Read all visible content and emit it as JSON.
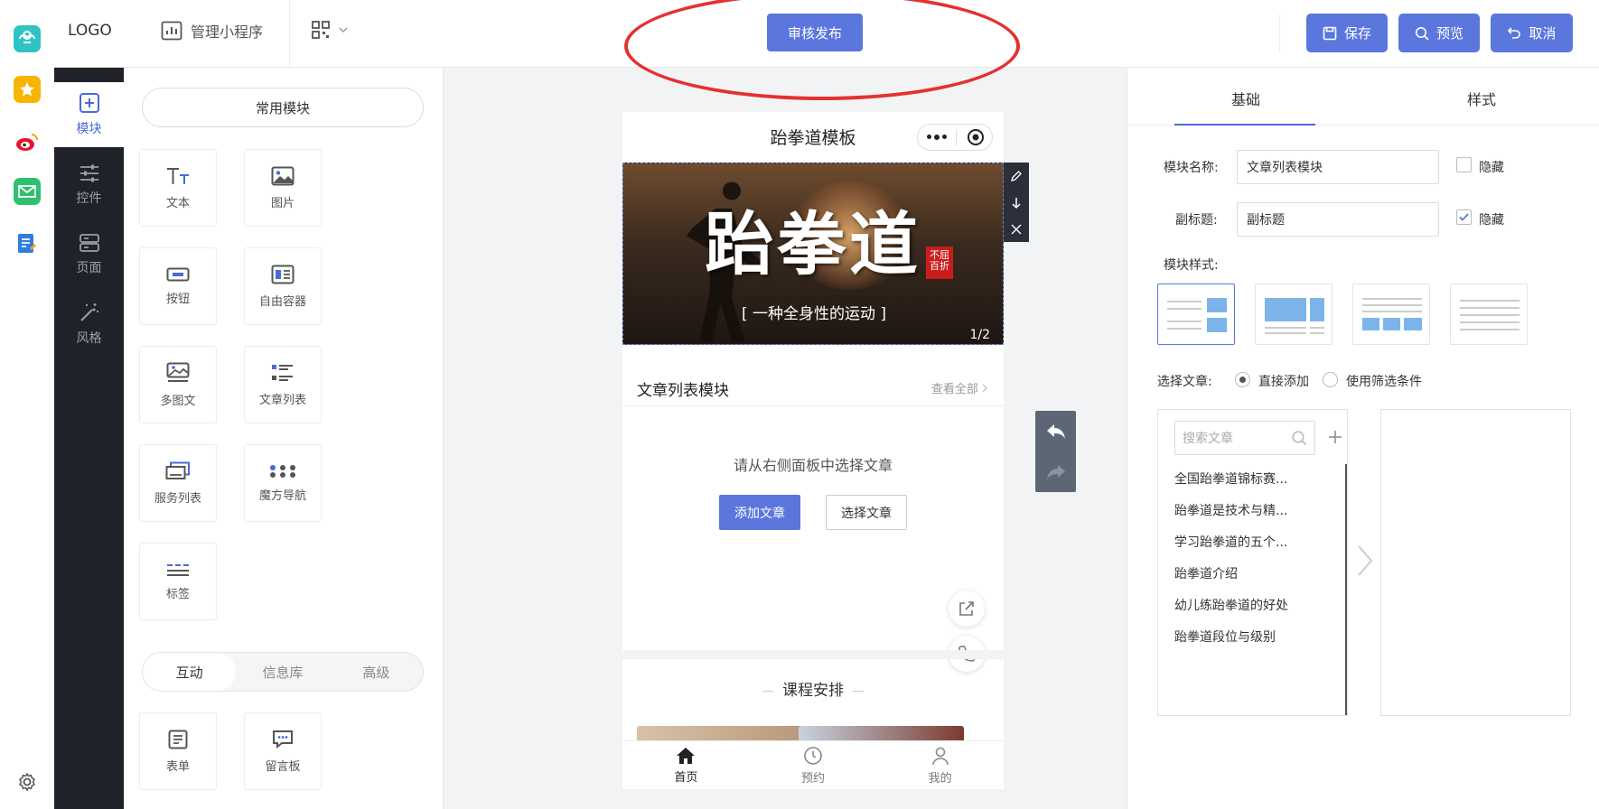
{
  "topbar": {
    "logo": "LOGO",
    "manage": "管理小程序",
    "publish": "审核发布",
    "save": "保存",
    "preview": "预览",
    "cancel": "取消"
  },
  "nav": {
    "modules": "模块",
    "controls": "控件",
    "pages": "页面",
    "style": "风格"
  },
  "widgets": {
    "common_tab": "常用模块",
    "text": "文本",
    "image": "图片",
    "button": "按钮",
    "free_container": "自由容器",
    "multi_image_text": "多图文",
    "article_list": "文章列表",
    "service_list": "服务列表",
    "magic_nav": "魔方导航",
    "tag": "标签",
    "lower_tabs": [
      "互动",
      "信息库",
      "高级"
    ],
    "form": "表单",
    "message_board": "留言板"
  },
  "phone": {
    "title": "跆拳道模板",
    "banner_title": "跆拳道",
    "banner_seal": "不屈百折",
    "banner_subtitle": "[ 一种全身性的运动 ]",
    "banner_page": "1/2",
    "article_module_title": "文章列表模块",
    "view_all": "查看全部",
    "hint": "请从右侧面板中选择文章",
    "add_article": "添加文章",
    "choose_article": "选择文章",
    "course_title": "课程安排",
    "tabbar": [
      "首页",
      "预约",
      "我的"
    ]
  },
  "props": {
    "tab_basic": "基础",
    "tab_style": "样式",
    "name_label": "模块名称:",
    "name_value": "文章列表模块",
    "hide1": "隐藏",
    "hide1_checked": false,
    "subtitle_label": "副标题:",
    "subtitle_value": "副标题",
    "hide2": "隐藏",
    "hide2_checked": true,
    "module_style_label": "模块样式:",
    "choose_label": "选择文章:",
    "direct_add": "直接添加",
    "use_filter": "使用筛选条件",
    "search_placeholder": "搜索文章",
    "articles": [
      "全国跆拳道锦标赛...",
      "跆拳道是技术与精...",
      "学习跆拳道的五个...",
      "跆拳道介绍",
      "幼儿练跆拳道的好处",
      "跆拳道段位与级别"
    ]
  },
  "colors": {
    "accent": "#5b77dd",
    "dark_nav": "#20222a",
    "annotation": "#e53030"
  }
}
